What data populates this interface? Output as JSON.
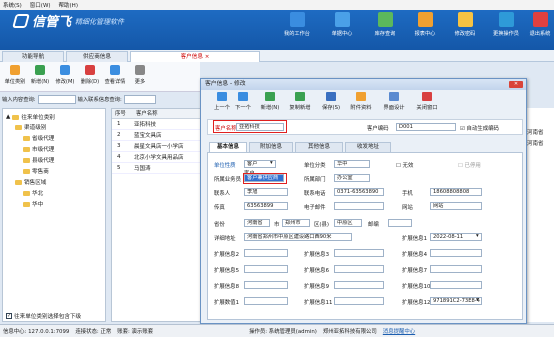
{
  "menu": [
    "系统(S)",
    "窗口(W)",
    "帮助(H)"
  ],
  "app": {
    "name": "信管飞",
    "subtitle": "精细化管理软件"
  },
  "top_buttons": [
    "我的工作台",
    "单据中心",
    "库存查询",
    "报表中心",
    "修改密码",
    "更换操作员",
    "退出系统"
  ],
  "top_colors": [
    "#3a8de0",
    "#4aa0e8",
    "#5cb85c",
    "#f0a030",
    "#f6c343",
    "#2e9ad8",
    "#e04040"
  ],
  "tabs": [
    "功能导航",
    "供应商信息",
    "客户信息"
  ],
  "toolbar": [
    "单位类别",
    "新增(N)",
    "修改(M)",
    "删除(D)",
    "查看详情",
    "更多"
  ],
  "filter": {
    "label1": "输入内容查询:",
    "label2": "输入联系信息查询:"
  },
  "tree": {
    "root": "往来单位类别",
    "nodes": [
      "渠道级别",
      "省级代理",
      "市级代理",
      "县级代理",
      "零售商",
      "销售区域",
      "华北",
      "华中"
    ],
    "footer": "往来单位类别选择包含下级"
  },
  "grid": {
    "headers": [
      "序号",
      "客户名称"
    ],
    "rows": [
      [
        "1",
        "亚拓科技"
      ],
      [
        "2",
        "蓝宝文具店"
      ],
      [
        "3",
        "晨星文具店一小学店"
      ],
      [
        "4",
        "北京小学文具用品店"
      ],
      [
        "5",
        "马国涛"
      ]
    ]
  },
  "right_partial": [
    "河南省",
    "河南省"
  ],
  "dialog": {
    "title": "客户信息 - 修改",
    "toolbar": [
      "上一个",
      "下一个",
      "新增(N)",
      "复制新增",
      "保存(S)",
      "附件资料",
      "界面设计",
      "关闭窗口"
    ],
    "name_label": "客户名称",
    "name_value": "亚拓科技",
    "code_label": "客户编码",
    "code_value": "D001",
    "auto_code": "自动生成编码",
    "tabs": [
      "基本信息",
      "附加信息",
      "其他信息",
      "收发地址"
    ],
    "fields": {
      "unit_type_l": "单位性质",
      "unit_type_v": "客户",
      "unit_type_opt1": "客户",
      "unit_type_opt2": "客户兼供应商",
      "unit_l": "单位分类",
      "unit_v": "华中",
      "invalid": "无效",
      "disabled": "已停用",
      "sales_l": "所属业务员",
      "dept_l": "所属部门",
      "dept_v": "办公室",
      "contact_l": "联系人",
      "contact_v": "李旭",
      "phone_l": "联系电话",
      "phone_v": "0371-63563890",
      "mobile_l": "手机",
      "mobile_v": "18608808808",
      "fax_l": "传真",
      "fax_v": "63563899",
      "email_l": "电子邮件",
      "web_l": "网站",
      "province_l": "省份",
      "province_v": "河南省",
      "city_l": "市",
      "city_v": "郑州市",
      "district_l": "区(县)",
      "district_v": "中原区",
      "zip_l": "邮编",
      "addr_l": "详细地址",
      "addr_v": "河南省郑州市中原区建设路口西90米",
      "ext1_l": "扩展信息1",
      "ext1_v": "2022-08-11",
      "ext_labels": [
        "扩展信息2",
        "扩展信息3",
        "扩展信息4",
        "扩展信息5",
        "扩展信息6",
        "扩展信息7",
        "扩展信息8",
        "扩展信息9",
        "扩展信息10",
        "扩展数值1",
        "扩展信息11",
        "扩展信息12"
      ],
      "lastval": "971891C2-73E8-4"
    }
  },
  "status": {
    "server": "信息中心: 127.0.0.1:7099",
    "conn": "连接状态: 正常",
    "account": "账套: 演示账套",
    "operator": "操作员: 系统管理员(admin)",
    "company": "郑州亚拓科技有限公司",
    "msg": "消息提醒中心"
  }
}
